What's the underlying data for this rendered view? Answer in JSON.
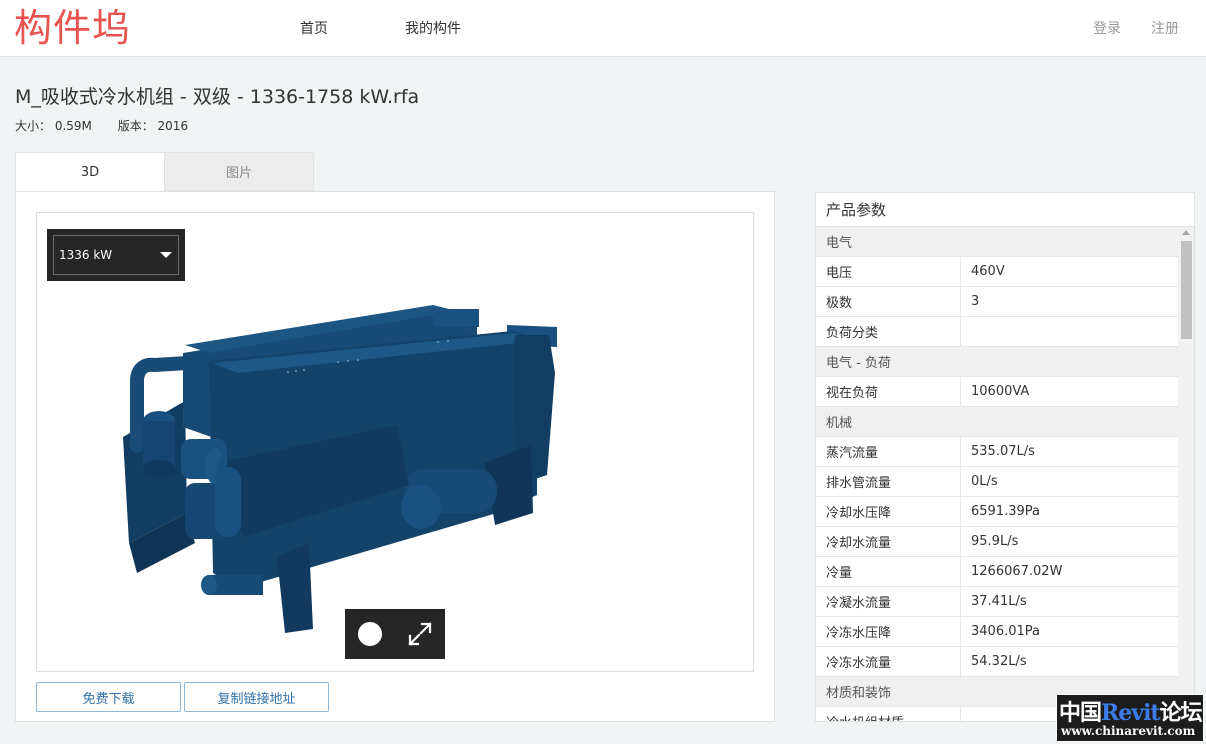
{
  "header": {
    "logo": "构件坞",
    "nav": {
      "home": "首页",
      "my_components": "我的构件"
    },
    "auth": {
      "login": "登录",
      "register": "注册"
    }
  },
  "file": {
    "title": "M_吸收式冷水机组 - 双级 - 1336-1758 kW.rfa",
    "size": "大小： 0.59M",
    "version": "版本： 2016"
  },
  "tabs": {
    "three_d": "3D",
    "images": "图片"
  },
  "viewer": {
    "model_select": "1336 kW",
    "model_color": "#14436a"
  },
  "actions": {
    "download": "免费下载",
    "copy_link": "复制链接地址"
  },
  "params": {
    "title": "产品参数",
    "rows": [
      {
        "group": "电气"
      },
      {
        "key": "电压",
        "value": "460V"
      },
      {
        "key": "极数",
        "value": "3"
      },
      {
        "key": "负荷分类",
        "value": ""
      },
      {
        "group": "电气 - 负荷"
      },
      {
        "key": "视在负荷",
        "value": "10600VA"
      },
      {
        "group": "机械"
      },
      {
        "key": "蒸汽流量",
        "value": "535.07L/s"
      },
      {
        "key": "排水管流量",
        "value": "0L/s"
      },
      {
        "key": "冷却水压降",
        "value": "6591.39Pa"
      },
      {
        "key": "冷却水流量",
        "value": "95.9L/s"
      },
      {
        "key": "冷量",
        "value": "1266067.02W"
      },
      {
        "key": "冷凝水流量",
        "value": "37.41L/s"
      },
      {
        "key": "冷冻水压降",
        "value": "3406.01Pa"
      },
      {
        "key": "冷冻水流量",
        "value": "54.32L/s"
      },
      {
        "group": "材质和装饰"
      },
      {
        "key": "冷水机组材质",
        "value": ""
      }
    ]
  },
  "watermark": {
    "prefix": "中国",
    "brand": "Revit",
    "suffix": "论坛",
    "url": "www.chinarevit.com"
  }
}
